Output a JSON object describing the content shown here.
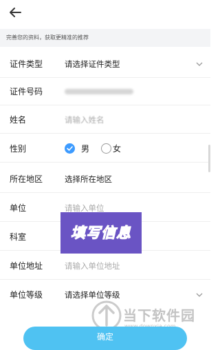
{
  "hint": "完善您的资料，获取更精准的推荐",
  "form": {
    "cert_type": {
      "label": "证件类型",
      "value": "请选择证件类型"
    },
    "cert_no": {
      "label": "证件号码",
      "value": "3412271994021080"
    },
    "name": {
      "label": "姓名",
      "placeholder": "请输入姓名"
    },
    "gender": {
      "label": "性别",
      "options": [
        "男",
        "女"
      ],
      "selected": "男"
    },
    "region": {
      "label": "所在地区",
      "value": "选择所在地区"
    },
    "unit": {
      "label": "单位",
      "placeholder": "请输入单位"
    },
    "department": {
      "label": "科室"
    },
    "unit_address": {
      "label": "单位地址",
      "placeholder": "请输入单位地址"
    },
    "unit_level": {
      "label": "单位等级",
      "value": "请选择单位等级"
    }
  },
  "overlay_text": "填写信息",
  "confirm_label": "确定",
  "watermark": {
    "brand": "当下软件园",
    "url": "www.downxia.com"
  },
  "colors": {
    "accent": "#3d9bff",
    "button": "#4fc2f2",
    "stamp_bg": "#6a54c4",
    "stamp_text": "#ff3b30"
  }
}
